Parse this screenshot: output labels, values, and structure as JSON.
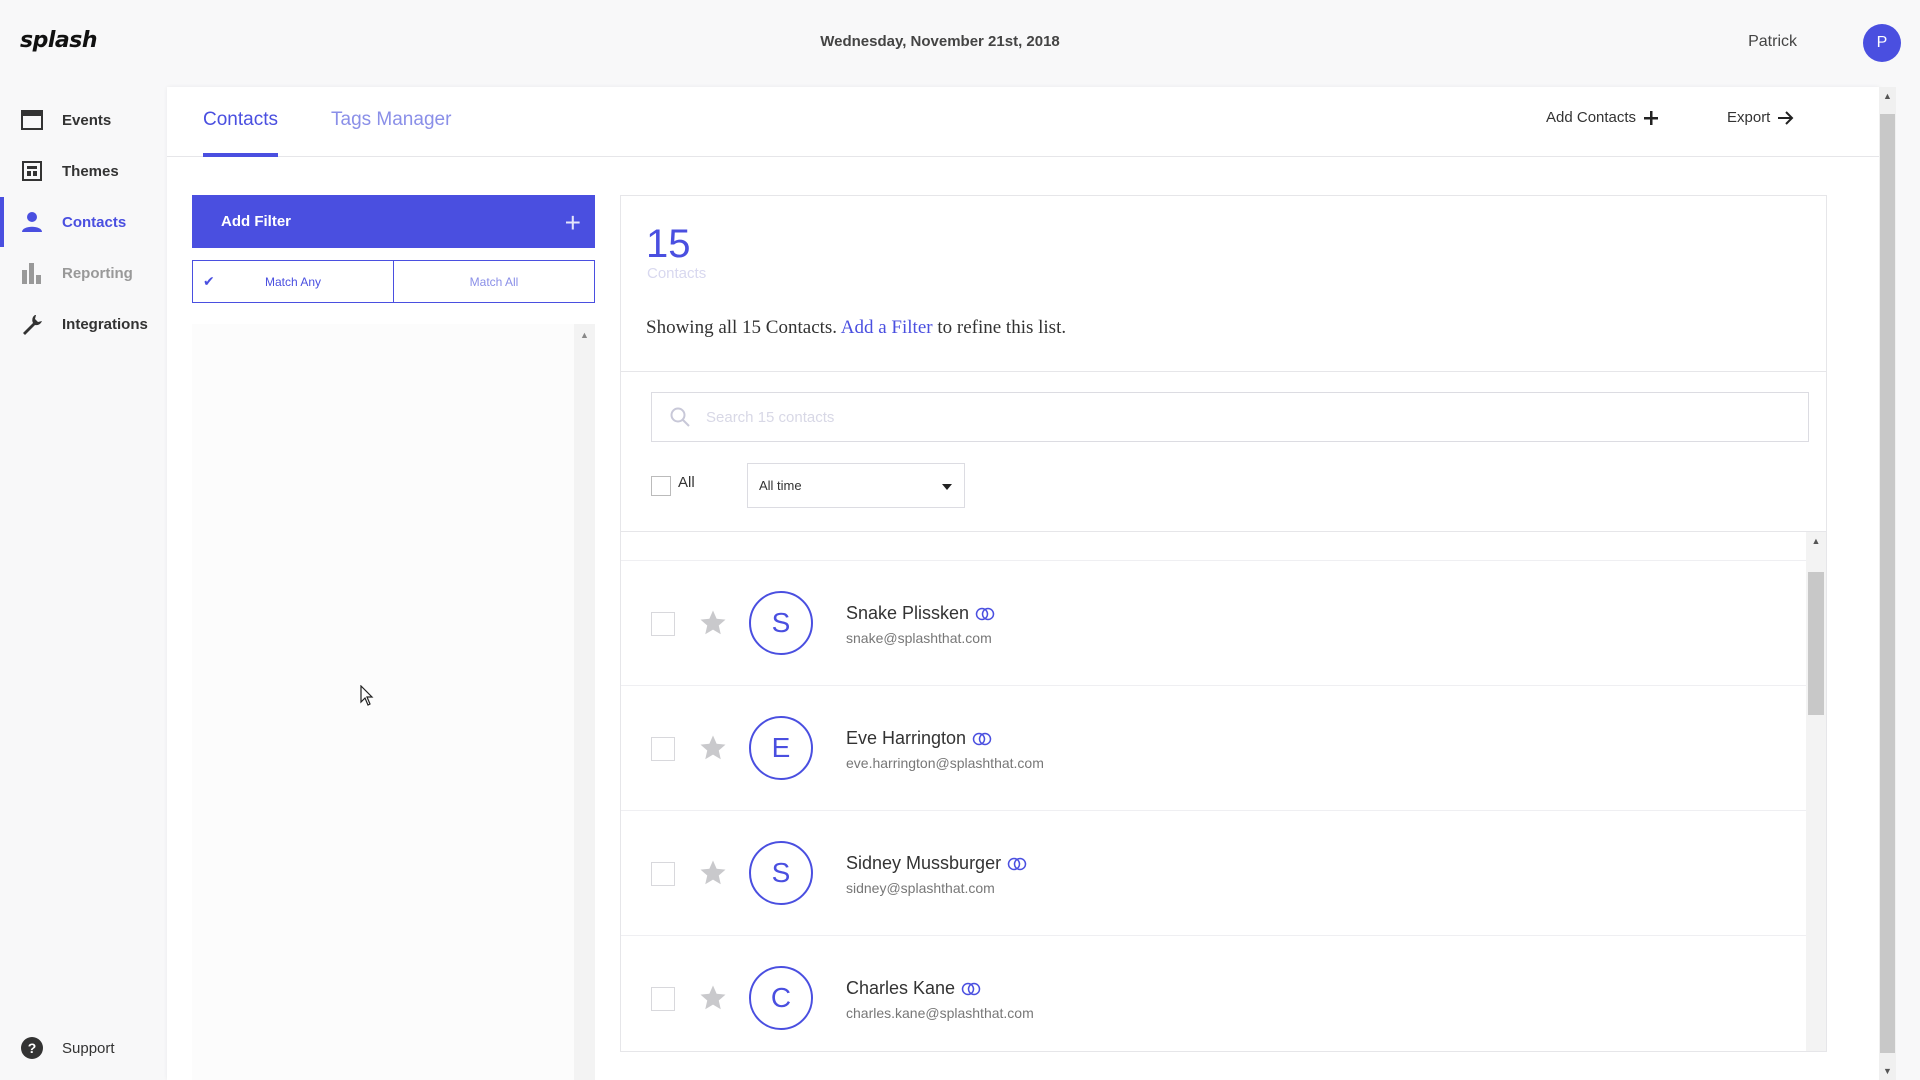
{
  "header": {
    "logo": "splash",
    "date": "Wednesday, November 21st, 2018",
    "user_name": "Patrick",
    "avatar_initial": "P"
  },
  "sidebar": {
    "items": [
      {
        "label": "Events",
        "icon": "calendar-icon"
      },
      {
        "label": "Themes",
        "icon": "layout-icon"
      },
      {
        "label": "Contacts",
        "icon": "person-icon",
        "active": true
      },
      {
        "label": "Reporting",
        "icon": "bar-chart-icon",
        "disabled": true
      },
      {
        "label": "Integrations",
        "icon": "wrench-icon"
      }
    ],
    "support": {
      "label": "Support",
      "icon": "help-icon"
    }
  },
  "tabs": [
    {
      "label": "Contacts",
      "active": true
    },
    {
      "label": "Tags Manager",
      "active": false
    }
  ],
  "actions": {
    "add_contacts": "Add Contacts",
    "export": "Export"
  },
  "filters": {
    "add_filter_label": "Add Filter",
    "match_any": "Match Any",
    "match_all": "Match All",
    "selected": "Match Any"
  },
  "contacts": {
    "count": "15",
    "count_label": "Contacts",
    "summary_pre": "Showing all 15 Contacts.",
    "summary_link": "Add a Filter",
    "summary_post": "to refine this list.",
    "search_placeholder": "Search 15 contacts",
    "all_label": "All",
    "time_filter": "All time",
    "list": [
      {
        "initial": "S",
        "name": "Snake Plissken",
        "email": "snake@splashthat.com"
      },
      {
        "initial": "E",
        "name": "Eve Harrington",
        "email": "eve.harrington@splashthat.com"
      },
      {
        "initial": "S",
        "name": "Sidney Mussburger",
        "email": "sidney@splashthat.com"
      },
      {
        "initial": "C",
        "name": "Charles Kane",
        "email": "charles.kane@splashthat.com"
      }
    ]
  },
  "colors": {
    "accent": "#4a4fe0",
    "accent_light": "#8a8fe8",
    "background": "#f8f8f9"
  }
}
